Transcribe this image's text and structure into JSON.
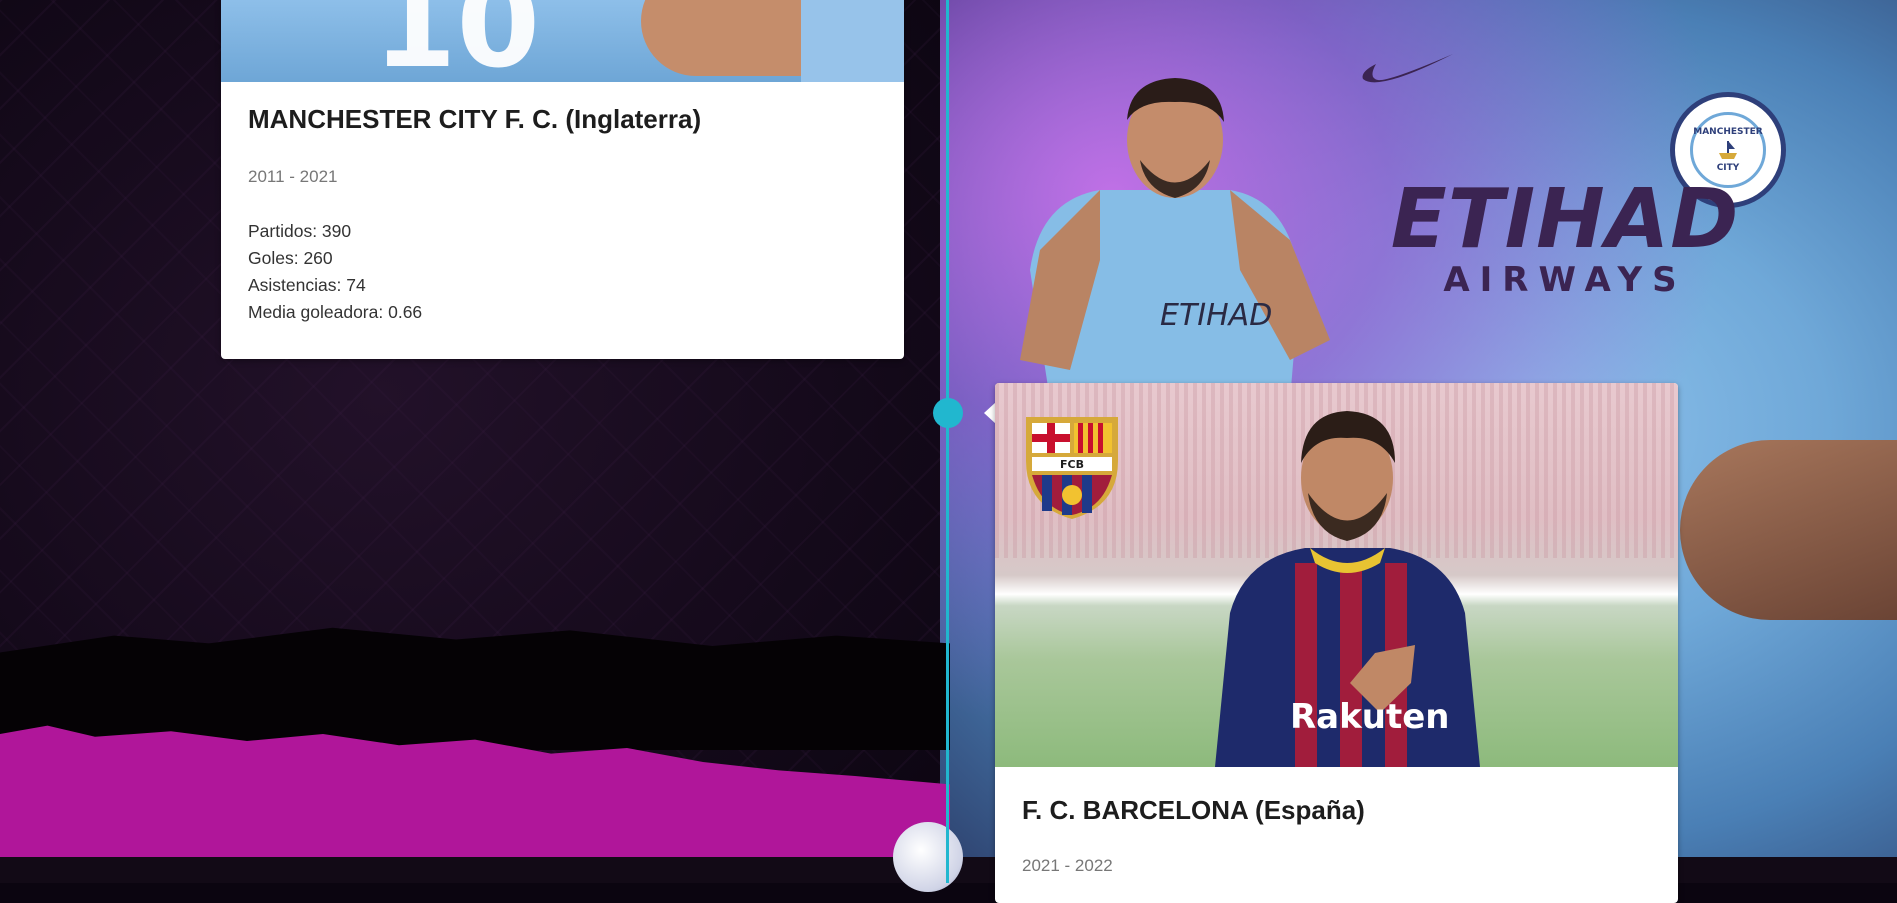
{
  "timeline": {
    "entries": [
      {
        "club": "MANCHESTER CITY F. C. (Inglaterra)",
        "years": "2011 - 2021",
        "stats": [
          "Partidos: 390",
          "Goles: 260",
          "Asistencias: 74",
          "Media goleadora: 0.66"
        ],
        "image_text": "10"
      },
      {
        "club": "F. C. BARCELONA (España)",
        "years": "2021 - 2022",
        "crest_text": "FCB"
      }
    ]
  },
  "background": {
    "sponsor_main": "ETIHAD",
    "sponsor_sub": "AIRWAYS",
    "crest_top": "MANCHESTER",
    "crest_bottom": "CITY"
  },
  "colors": {
    "timeline": "#21b7cf",
    "magenta": "#b0169a",
    "card_bg": "#ffffff"
  }
}
